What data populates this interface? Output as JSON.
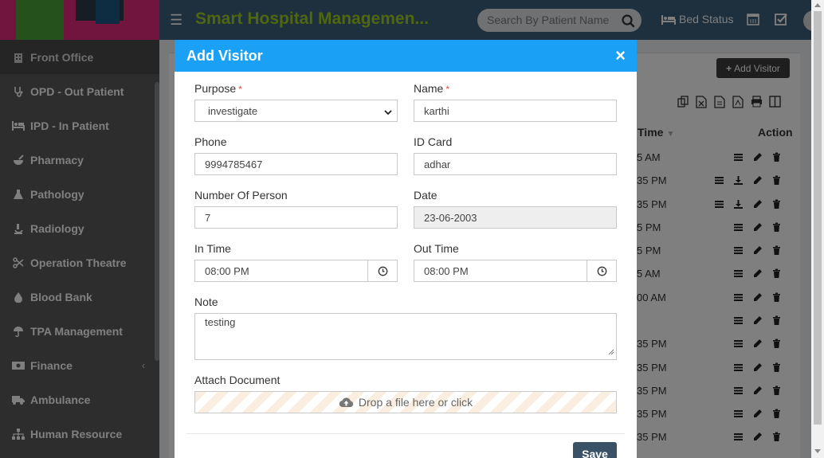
{
  "header": {
    "app_title": "Smart Hospital Managemen...",
    "search_placeholder": "Search By Patient Name",
    "bed_status_label": "Bed Status"
  },
  "sidebar": {
    "items": [
      {
        "label": "Front Office",
        "icon": "building-icon"
      },
      {
        "label": "OPD - Out Patient",
        "icon": "stethoscope-icon"
      },
      {
        "label": "IPD - In Patient",
        "icon": "bed-icon"
      },
      {
        "label": "Pharmacy",
        "icon": "mortar-pestle-icon"
      },
      {
        "label": "Pathology",
        "icon": "flask-icon"
      },
      {
        "label": "Radiology",
        "icon": "microscope-icon"
      },
      {
        "label": "Operation Theatre",
        "icon": "scissors-icon"
      },
      {
        "label": "Blood Bank",
        "icon": "droplet-icon"
      },
      {
        "label": "TPA Management",
        "icon": "umbrella-icon"
      },
      {
        "label": "Finance",
        "icon": "money-icon"
      },
      {
        "label": "Ambulance",
        "icon": "ambulance-icon"
      },
      {
        "label": "Human Resource",
        "icon": "sitemap-icon"
      }
    ]
  },
  "page": {
    "add_visitor_button": "Add Visitor",
    "columns": {
      "time": "Time",
      "action": "Action"
    },
    "rows": [
      {
        "time": "5 AM"
      },
      {
        "time": "35 PM"
      },
      {
        "time": "35 PM"
      },
      {
        "time": "5 PM"
      },
      {
        "time": "5 PM"
      },
      {
        "time": "5 AM"
      },
      {
        "time": "00 AM"
      },
      {
        "time": ""
      },
      {
        "time": "35 PM"
      },
      {
        "time": "35 PM"
      },
      {
        "time": "35 PM"
      },
      {
        "time": "35 PM"
      },
      {
        "time": "35 PM"
      }
    ]
  },
  "modal": {
    "title": "Add Visitor",
    "close_symbol": "×",
    "purpose": {
      "label": "Purpose",
      "required_mark": "*",
      "value": "investigate"
    },
    "name": {
      "label": "Name",
      "required_mark": "*",
      "value": "karthi"
    },
    "phone": {
      "label": "Phone",
      "value": "9994785467"
    },
    "id_card": {
      "label": "ID Card",
      "value": "adhar"
    },
    "number_of_person": {
      "label": "Number Of Person",
      "value": "7"
    },
    "date": {
      "label": "Date",
      "value": "23-06-2003"
    },
    "in_time": {
      "label": "In Time",
      "value": "08:00 PM"
    },
    "out_time": {
      "label": "Out Time",
      "value": "08:00 PM"
    },
    "note": {
      "label": "Note",
      "value": "testing"
    },
    "attach": {
      "label": "Attach Document",
      "dropzone_text": "Drop a file here or click"
    },
    "save_label": "Save"
  },
  "colors": {
    "modal_header": "#1aa1f5",
    "topbar": "#3c5f7a",
    "sidebar": "#5b5b5b",
    "app_title": "#9fcf1f",
    "save_button": "#3a5266",
    "required": "#e74c3c"
  }
}
